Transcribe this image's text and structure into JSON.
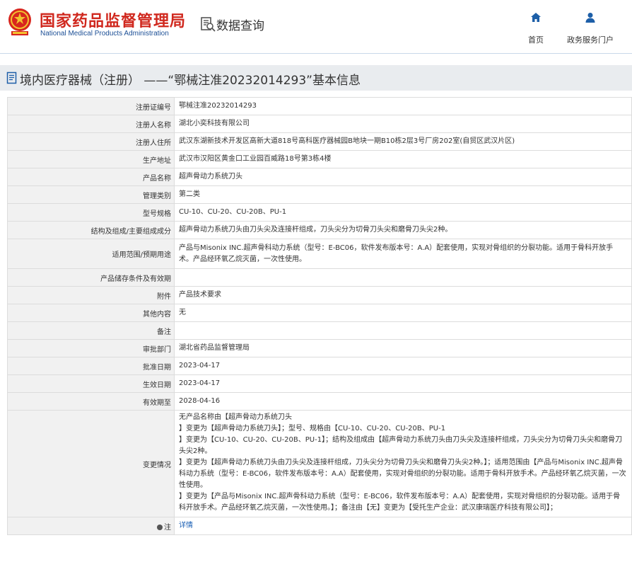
{
  "header": {
    "logo_cn": "国家药品监督管理局",
    "logo_en": "National Medical Products Administration",
    "data_query": "数据查询",
    "nav": [
      {
        "label": "首页",
        "icon": "home-icon"
      },
      {
        "label": "政务服务门户",
        "icon": "user-icon"
      }
    ]
  },
  "title": "境内医疗器械（注册） ——“鄂械注准20232014293”基本信息",
  "rows": [
    {
      "label": "注册证编号",
      "value": "鄂械注准20232014293"
    },
    {
      "label": "注册人名称",
      "value": "湖北小奕科技有限公司"
    },
    {
      "label": "注册人住所",
      "value": "武汉东湖新技术开发区高新大道818号高科医疗器械园B地块一期B10栋2层3号厂房202室(自贸区武汉片区)"
    },
    {
      "label": "生产地址",
      "value": "武汉市汉阳区黄金口工业园百威路18号第3栋4楼"
    },
    {
      "label": "产品名称",
      "value": "超声骨动力系统刀头"
    },
    {
      "label": "管理类别",
      "value": "第二类"
    },
    {
      "label": "型号规格",
      "value": "CU-10、CU-20、CU-20B、PU-1"
    },
    {
      "label": "结构及组成/主要组成成分",
      "value": "超声骨动力系统刀头由刀头尖及连接杆组成，刀头尖分为切骨刀头尖和磨骨刀头尖2种。"
    },
    {
      "label": "适用范围/预期用途",
      "value": "产品与Misonix INC.超声骨科动力系统（型号：E-BC06，软件发布版本号：A.A）配套使用，实现对骨组织的分裂功能。适用于骨科开放手术。产品经环氧乙烷灭菌，一次性使用。"
    },
    {
      "label": "产品储存条件及有效期",
      "value": ""
    },
    {
      "label": "附件",
      "value": "产品技术要求"
    },
    {
      "label": "其他内容",
      "value": "无"
    },
    {
      "label": "备注",
      "value": ""
    },
    {
      "label": "审批部门",
      "value": "湖北省药品监督管理局"
    },
    {
      "label": "批准日期",
      "value": "2023-04-17"
    },
    {
      "label": "生效日期",
      "value": "2023-04-17"
    },
    {
      "label": "有效期至",
      "value": "2028-04-16"
    }
  ],
  "change": {
    "label": "变更情况",
    "lines": [
      "无产品名称由【超声骨动力系统刀头",
      "】变更为【超声骨动力系统刀头】；型号、规格由【CU-10、CU-20、CU-20B、PU-1",
      "】变更为【CU-10、CU-20、CU-20B、PU-1】；结构及组成由【超声骨动力系统刀头由刀头尖及连接杆组成，刀头尖分为切骨刀头尖和磨骨刀头尖2种。",
      "】变更为【超声骨动力系统刀头由刀头尖及连接杆组成，刀头尖分为切骨刀头尖和磨骨刀头尖2种。】；适用范围由【产品与Misonix INC.超声骨科动力系统（型号：E-BC06，软件发布版本号：A.A）配套使用，实现对骨组织的分裂功能。适用于骨科开放手术。产品经环氧乙烷灭菌，一次性使用。",
      "】变更为【产品与Misonix INC.超声骨科动力系统（型号：E-BC06，软件发布版本号：A.A）配套使用，实现对骨组织的分裂功能。适用于骨科开放手术。产品经环氧乙烷灭菌，一次性使用。】；备注由【无】变更为【受托生产企业：武汉康瑞医疗科技有限公司】；"
    ]
  },
  "note": {
    "label": "注",
    "link": "详情"
  }
}
